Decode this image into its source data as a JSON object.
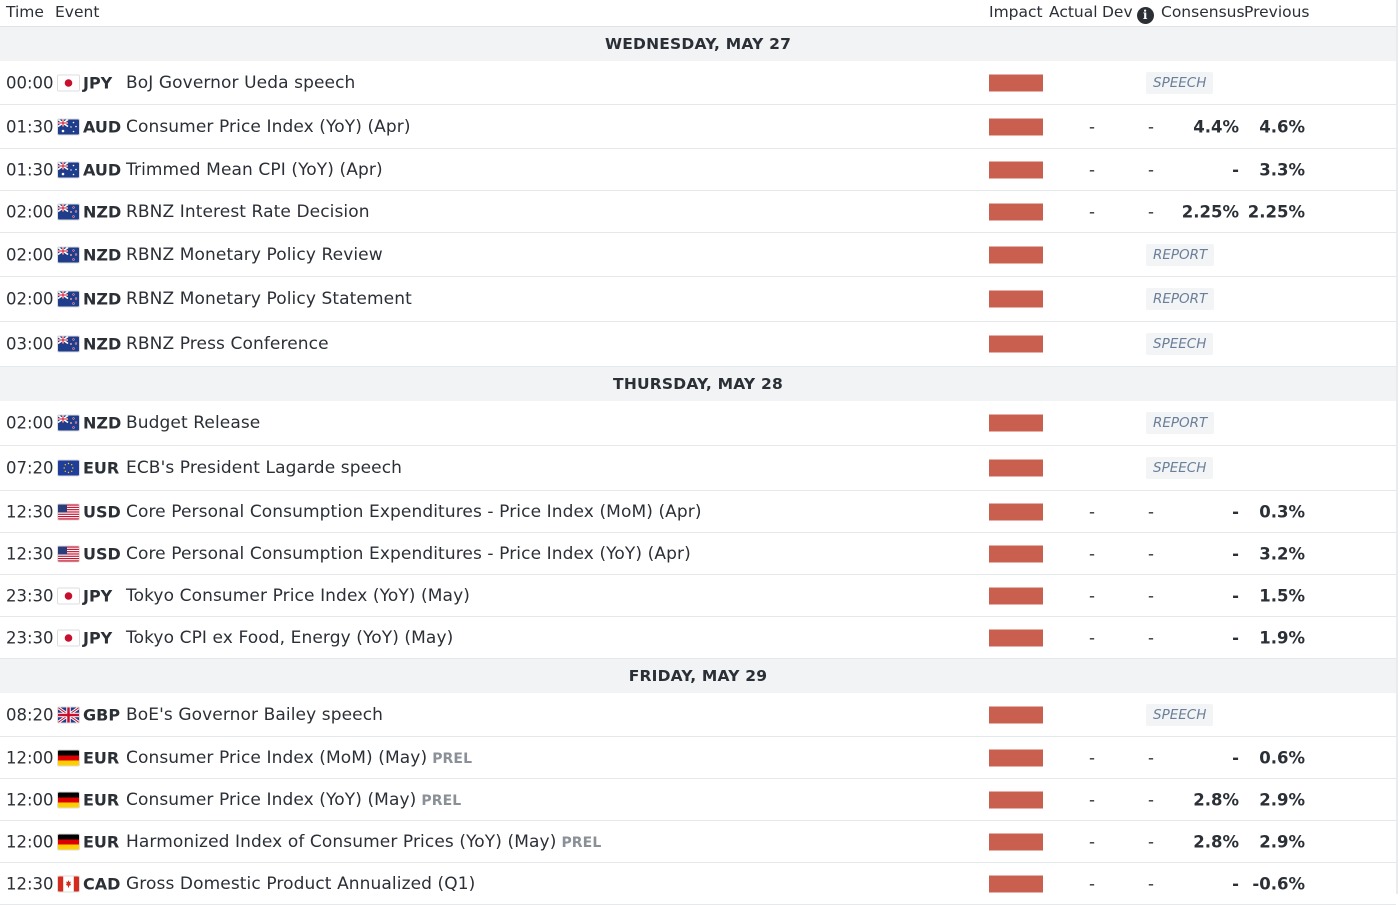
{
  "header": {
    "time": "Time",
    "event": "Event",
    "impact": "Impact",
    "actual": "Actual",
    "dev": "Dev",
    "info_icon": "i",
    "consensus": "Consensus",
    "previous": "Previous"
  },
  "colors": {
    "impact_bar": "#c9604f",
    "day_bg": "#f1f3f5",
    "tag_text": "#6b7f99"
  },
  "days": [
    {
      "label": "WEDNESDAY, MAY 27",
      "events": [
        {
          "time": "00:00",
          "flag": "jp",
          "currency": "JPY",
          "name": "BoJ Governor Ueda speech",
          "prel": "",
          "tag": "SPEECH",
          "actual": "",
          "dev": "",
          "consensus": "",
          "previous": ""
        },
        {
          "time": "01:30",
          "flag": "au",
          "currency": "AUD",
          "name": "Consumer Price Index (YoY) (Apr)",
          "prel": "",
          "tag": "",
          "actual": "-",
          "dev": "-",
          "consensus": "4.4%",
          "previous": "4.6%"
        },
        {
          "time": "01:30",
          "flag": "au",
          "currency": "AUD",
          "name": "Trimmed Mean CPI (YoY) (Apr)",
          "prel": "",
          "tag": "",
          "actual": "-",
          "dev": "-",
          "consensus": "-",
          "previous": "3.3%"
        },
        {
          "time": "02:00",
          "flag": "nz",
          "currency": "NZD",
          "name": "RBNZ Interest Rate Decision",
          "prel": "",
          "tag": "",
          "actual": "-",
          "dev": "-",
          "consensus": "2.25%",
          "previous": "2.25%"
        },
        {
          "time": "02:00",
          "flag": "nz",
          "currency": "NZD",
          "name": "RBNZ Monetary Policy Review",
          "prel": "",
          "tag": "REPORT",
          "actual": "",
          "dev": "",
          "consensus": "",
          "previous": ""
        },
        {
          "time": "02:00",
          "flag": "nz",
          "currency": "NZD",
          "name": "RBNZ Monetary Policy Statement",
          "prel": "",
          "tag": "REPORT",
          "actual": "",
          "dev": "",
          "consensus": "",
          "previous": ""
        },
        {
          "time": "03:00",
          "flag": "nz",
          "currency": "NZD",
          "name": "RBNZ Press Conference",
          "prel": "",
          "tag": "SPEECH",
          "actual": "",
          "dev": "",
          "consensus": "",
          "previous": ""
        }
      ]
    },
    {
      "label": "THURSDAY, MAY 28",
      "events": [
        {
          "time": "02:00",
          "flag": "nz",
          "currency": "NZD",
          "name": "Budget Release",
          "prel": "",
          "tag": "REPORT",
          "actual": "",
          "dev": "",
          "consensus": "",
          "previous": ""
        },
        {
          "time": "07:20",
          "flag": "eu",
          "currency": "EUR",
          "name": "ECB's President Lagarde speech",
          "prel": "",
          "tag": "SPEECH",
          "actual": "",
          "dev": "",
          "consensus": "",
          "previous": ""
        },
        {
          "time": "12:30",
          "flag": "us",
          "currency": "USD",
          "name": "Core Personal Consumption Expenditures - Price Index (MoM) (Apr)",
          "prel": "",
          "tag": "",
          "actual": "-",
          "dev": "-",
          "consensus": "-",
          "previous": "0.3%"
        },
        {
          "time": "12:30",
          "flag": "us",
          "currency": "USD",
          "name": "Core Personal Consumption Expenditures - Price Index (YoY) (Apr)",
          "prel": "",
          "tag": "",
          "actual": "-",
          "dev": "-",
          "consensus": "-",
          "previous": "3.2%"
        },
        {
          "time": "23:30",
          "flag": "jp",
          "currency": "JPY",
          "name": "Tokyo Consumer Price Index (YoY) (May)",
          "prel": "",
          "tag": "",
          "actual": "-",
          "dev": "-",
          "consensus": "-",
          "previous": "1.5%"
        },
        {
          "time": "23:30",
          "flag": "jp",
          "currency": "JPY",
          "name": "Tokyo CPI ex Food, Energy (YoY) (May)",
          "prel": "",
          "tag": "",
          "actual": "-",
          "dev": "-",
          "consensus": "-",
          "previous": "1.9%"
        }
      ]
    },
    {
      "label": "FRIDAY, MAY 29",
      "events": [
        {
          "time": "08:20",
          "flag": "gb",
          "currency": "GBP",
          "name": "BoE's Governor Bailey speech",
          "prel": "",
          "tag": "SPEECH",
          "actual": "",
          "dev": "",
          "consensus": "",
          "previous": ""
        },
        {
          "time": "12:00",
          "flag": "de",
          "currency": "EUR",
          "name": "Consumer Price Index (MoM) (May)",
          "prel": "PREL",
          "tag": "",
          "actual": "-",
          "dev": "-",
          "consensus": "-",
          "previous": "0.6%"
        },
        {
          "time": "12:00",
          "flag": "de",
          "currency": "EUR",
          "name": "Consumer Price Index (YoY) (May)",
          "prel": "PREL",
          "tag": "",
          "actual": "-",
          "dev": "-",
          "consensus": "2.8%",
          "previous": "2.9%"
        },
        {
          "time": "12:00",
          "flag": "de",
          "currency": "EUR",
          "name": "Harmonized Index of Consumer Prices (YoY) (May)",
          "prel": "PREL",
          "tag": "",
          "actual": "-",
          "dev": "-",
          "consensus": "2.8%",
          "previous": "2.9%"
        },
        {
          "time": "12:30",
          "flag": "ca",
          "currency": "CAD",
          "name": "Gross Domestic Product Annualized (Q1)",
          "prel": "",
          "tag": "",
          "actual": "-",
          "dev": "-",
          "consensus": "-",
          "previous": "-0.6%"
        }
      ]
    }
  ]
}
